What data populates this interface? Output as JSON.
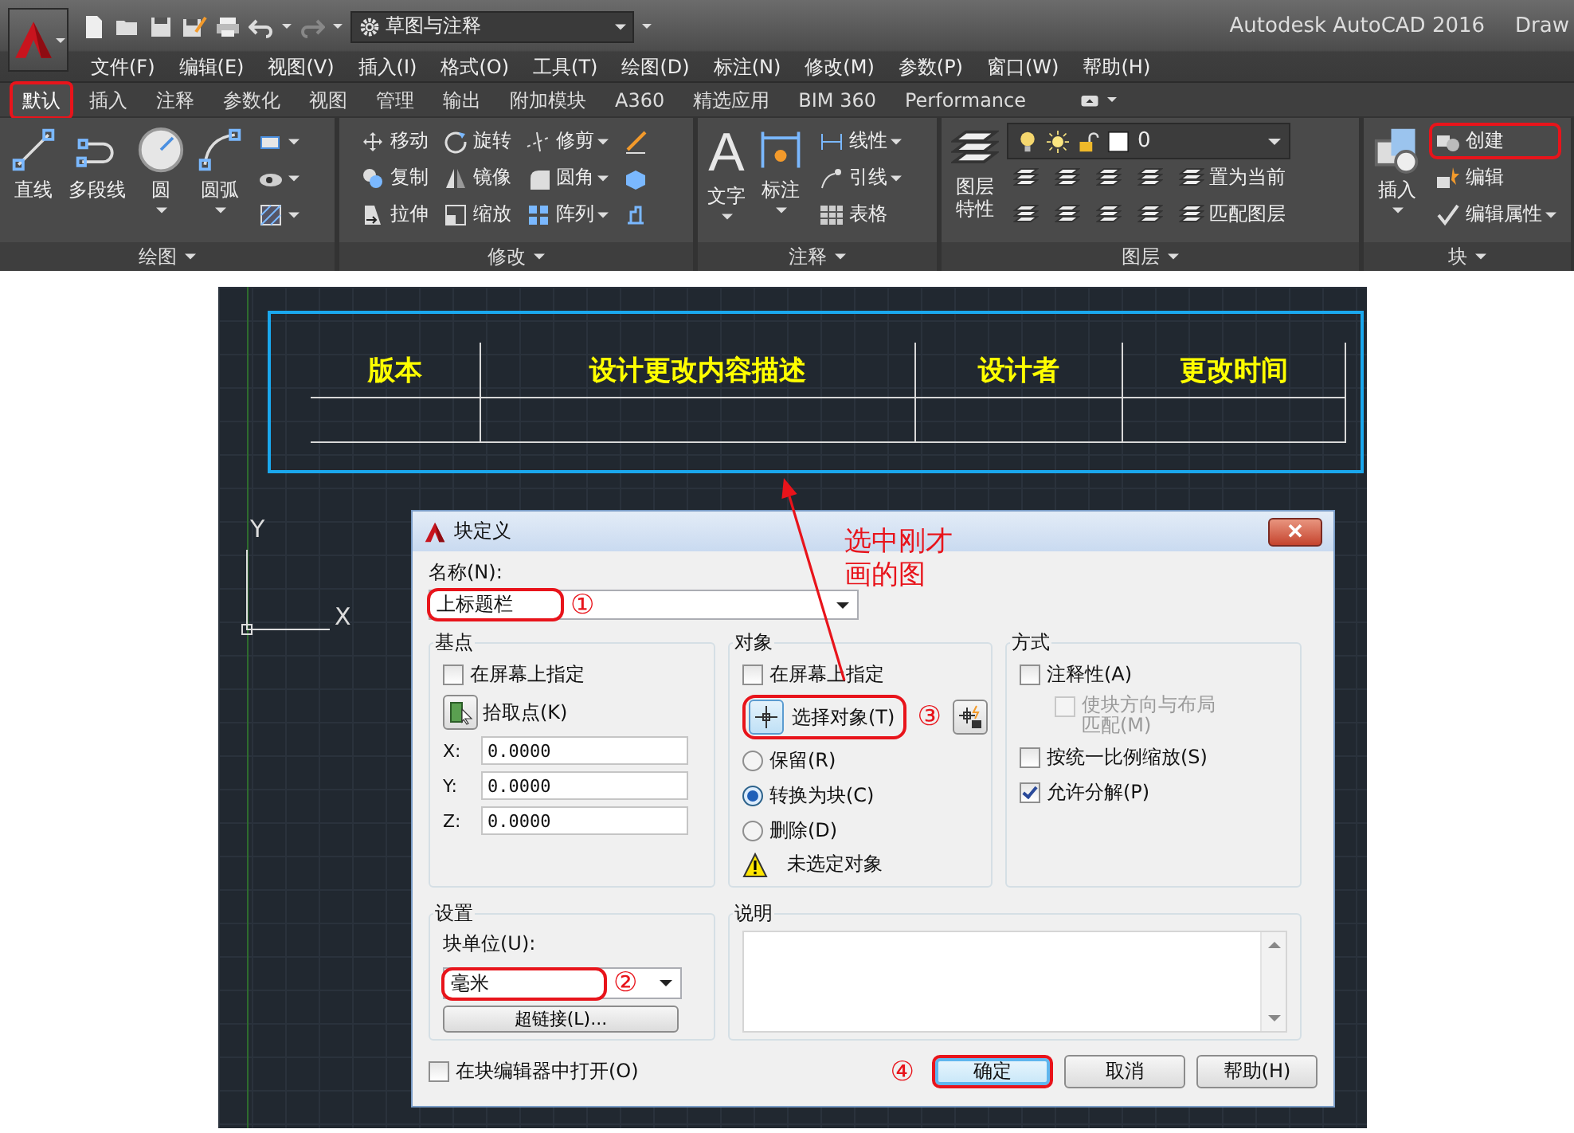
{
  "title_bar": {
    "workspace": "草图与注释",
    "title": "Autodesk AutoCAD 2016",
    "document": "Draw"
  },
  "menu": [
    "文件(F)",
    "编辑(E)",
    "视图(V)",
    "插入(I)",
    "格式(O)",
    "工具(T)",
    "绘图(D)",
    "标注(N)",
    "修改(M)",
    "参数(P)",
    "窗口(W)",
    "帮助(H)"
  ],
  "ribbon_tabs": [
    {
      "label": "默认",
      "selected": true,
      "highlighted": true
    },
    {
      "label": "插入",
      "selected": false,
      "highlighted": false
    },
    {
      "label": "注释",
      "selected": false,
      "highlighted": false
    },
    {
      "label": "参数化",
      "selected": false,
      "highlighted": false
    },
    {
      "label": "视图",
      "selected": false,
      "highlighted": false
    },
    {
      "label": "管理",
      "selected": false,
      "highlighted": false
    },
    {
      "label": "输出",
      "selected": false,
      "highlighted": false
    },
    {
      "label": "附加模块",
      "selected": false,
      "highlighted": false
    },
    {
      "label": "A360",
      "selected": false,
      "highlighted": false
    },
    {
      "label": "精选应用",
      "selected": false,
      "highlighted": false
    },
    {
      "label": "BIM 360",
      "selected": false,
      "highlighted": false
    },
    {
      "label": "Performance",
      "selected": false,
      "highlighted": false
    }
  ],
  "ribbon_panels": [
    {
      "title": "绘图",
      "tools": [
        {
          "kind": "large",
          "label": "直线",
          "dropdown": false,
          "highlighted": false
        },
        {
          "kind": "large",
          "label": "多段线",
          "dropdown": false,
          "highlighted": false
        },
        {
          "kind": "large",
          "label": "圆",
          "dropdown": true,
          "highlighted": false
        },
        {
          "kind": "large",
          "label": "圆弧",
          "dropdown": true,
          "highlighted": false
        },
        {
          "kind": "icon",
          "dropdown": true,
          "highlighted": false
        },
        {
          "kind": "icon",
          "dropdown": true,
          "highlighted": false
        },
        {
          "kind": "icon",
          "dropdown": true,
          "highlighted": false
        }
      ]
    },
    {
      "title": "修改",
      "tools": [
        {
          "kind": "small",
          "label": "移动",
          "dropdown": false,
          "highlighted": false
        },
        {
          "kind": "small",
          "label": "旋转",
          "dropdown": false,
          "highlighted": false
        },
        {
          "kind": "small",
          "label": "修剪",
          "dropdown": true,
          "highlighted": false
        },
        {
          "kind": "icon",
          "dropdown": false,
          "highlighted": false
        },
        {
          "kind": "small",
          "label": "复制",
          "dropdown": false,
          "highlighted": false
        },
        {
          "kind": "small",
          "label": "镜像",
          "dropdown": false,
          "highlighted": false
        },
        {
          "kind": "small",
          "label": "圆角",
          "dropdown": true,
          "highlighted": false
        },
        {
          "kind": "icon",
          "dropdown": false,
          "highlighted": false
        },
        {
          "kind": "small",
          "label": "拉伸",
          "dropdown": false,
          "highlighted": false
        },
        {
          "kind": "small",
          "label": "缩放",
          "dropdown": false,
          "highlighted": false
        },
        {
          "kind": "small",
          "label": "阵列",
          "dropdown": true,
          "highlighted": false
        },
        {
          "kind": "icon",
          "dropdown": false,
          "highlighted": false
        }
      ]
    },
    {
      "title": "注释",
      "tools": [
        {
          "kind": "large",
          "label": "文字",
          "glyph": "A",
          "dropdown": true,
          "highlighted": false
        },
        {
          "kind": "large",
          "label": "标注",
          "dropdown": true,
          "highlighted": false
        },
        {
          "kind": "small",
          "label": "线性",
          "dropdown": true,
          "highlighted": false
        },
        {
          "kind": "small",
          "label": "引线",
          "dropdown": true,
          "highlighted": false
        },
        {
          "kind": "small",
          "label": "表格",
          "dropdown": false,
          "highlighted": false
        }
      ]
    },
    {
      "title": "图层",
      "tools": [
        {
          "kind": "large",
          "label": "图层特性",
          "dropdown": false,
          "highlighted": false
        },
        {
          "kind": "combo",
          "value": "0",
          "dropdown": true,
          "highlighted": false
        },
        {
          "kind": "icon",
          "dropdown": false,
          "highlighted": false
        },
        {
          "kind": "icon",
          "dropdown": false,
          "highlighted": false
        },
        {
          "kind": "icon",
          "dropdown": false,
          "highlighted": false
        },
        {
          "kind": "icon",
          "dropdown": false,
          "highlighted": false
        },
        {
          "kind": "small",
          "label": "置为当前",
          "dropdown": false,
          "highlighted": false
        },
        {
          "kind": "icon",
          "dropdown": false,
          "highlighted": false
        },
        {
          "kind": "icon",
          "dropdown": false,
          "highlighted": false
        },
        {
          "kind": "icon",
          "dropdown": false,
          "highlighted": false
        },
        {
          "kind": "icon",
          "dropdown": false,
          "highlighted": false
        },
        {
          "kind": "small",
          "label": "匹配图层",
          "dropdown": false,
          "highlighted": false
        }
      ]
    },
    {
      "title": "块",
      "tools": [
        {
          "kind": "large",
          "label": "插入",
          "dropdown": true,
          "highlighted": false
        },
        {
          "kind": "small",
          "label": "创建",
          "dropdown": false,
          "highlighted": true
        },
        {
          "kind": "small",
          "label": "编辑",
          "dropdown": false,
          "highlighted": false
        },
        {
          "kind": "small",
          "label": "编辑属性",
          "dropdown": true,
          "highlighted": false
        }
      ]
    }
  ],
  "drawing": {
    "table_headers": [
      "版本",
      "设计更改内容描述",
      "设计者",
      "更改时间"
    ],
    "ucs": {
      "y_label": "Y",
      "x_label": "X"
    }
  },
  "dialog": {
    "title": "块定义",
    "name_label": "名称(N):",
    "name_field": {
      "value": "上标题栏",
      "highlighted": true,
      "callout": "①"
    },
    "base_point": {
      "title": "基点",
      "specify_on_screen": {
        "label": "在屏幕上指定",
        "checked": false
      },
      "pick_button": "拾取点(K)",
      "coords": [
        {
          "axis": "X:",
          "value": "0.0000"
        },
        {
          "axis": "Y:",
          "value": "0.0000"
        },
        {
          "axis": "Z:",
          "value": "0.0000"
        }
      ]
    },
    "objects": {
      "title": "对象",
      "specify_on_screen": {
        "label": "在屏幕上指定",
        "checked": false
      },
      "select_button": {
        "label": "选择对象(T)",
        "highlighted": true,
        "callout": "③"
      },
      "options": [
        {
          "label": "保留(R)",
          "selected": false
        },
        {
          "label": "转换为块(C)",
          "selected": true
        },
        {
          "label": "删除(D)",
          "selected": false
        }
      ],
      "warning": "未选定对象"
    },
    "behavior": {
      "title": "方式",
      "options": [
        {
          "label": "注释性(A)",
          "checked": false,
          "disabled": false,
          "children": [
            {
              "label": "使块方向与布局匹配(M)",
              "checked": false,
              "disabled": true
            }
          ]
        },
        {
          "label": "按统一比例缩放(S)",
          "checked": false,
          "disabled": false
        },
        {
          "label": "允许分解(P)",
          "checked": true,
          "disabled": false
        }
      ]
    },
    "settings": {
      "title": "设置",
      "unit_label": "块单位(U):",
      "unit": {
        "value": "毫米",
        "highlighted": true,
        "callout": "②"
      },
      "hyperlink_button": "超链接(L)..."
    },
    "description": {
      "title": "说明"
    },
    "open_in_editor": {
      "label": "在块编辑器中打开(O)",
      "checked": false
    },
    "buttons": [
      {
        "label": "确定",
        "highlighted": true,
        "focused": true,
        "callout": "④"
      },
      {
        "label": "取消",
        "highlighted": false,
        "focused": false
      },
      {
        "label": "帮助(H)",
        "highlighted": false,
        "focused": false
      }
    ]
  },
  "annotation": {
    "note": "选中刚才画的图"
  }
}
